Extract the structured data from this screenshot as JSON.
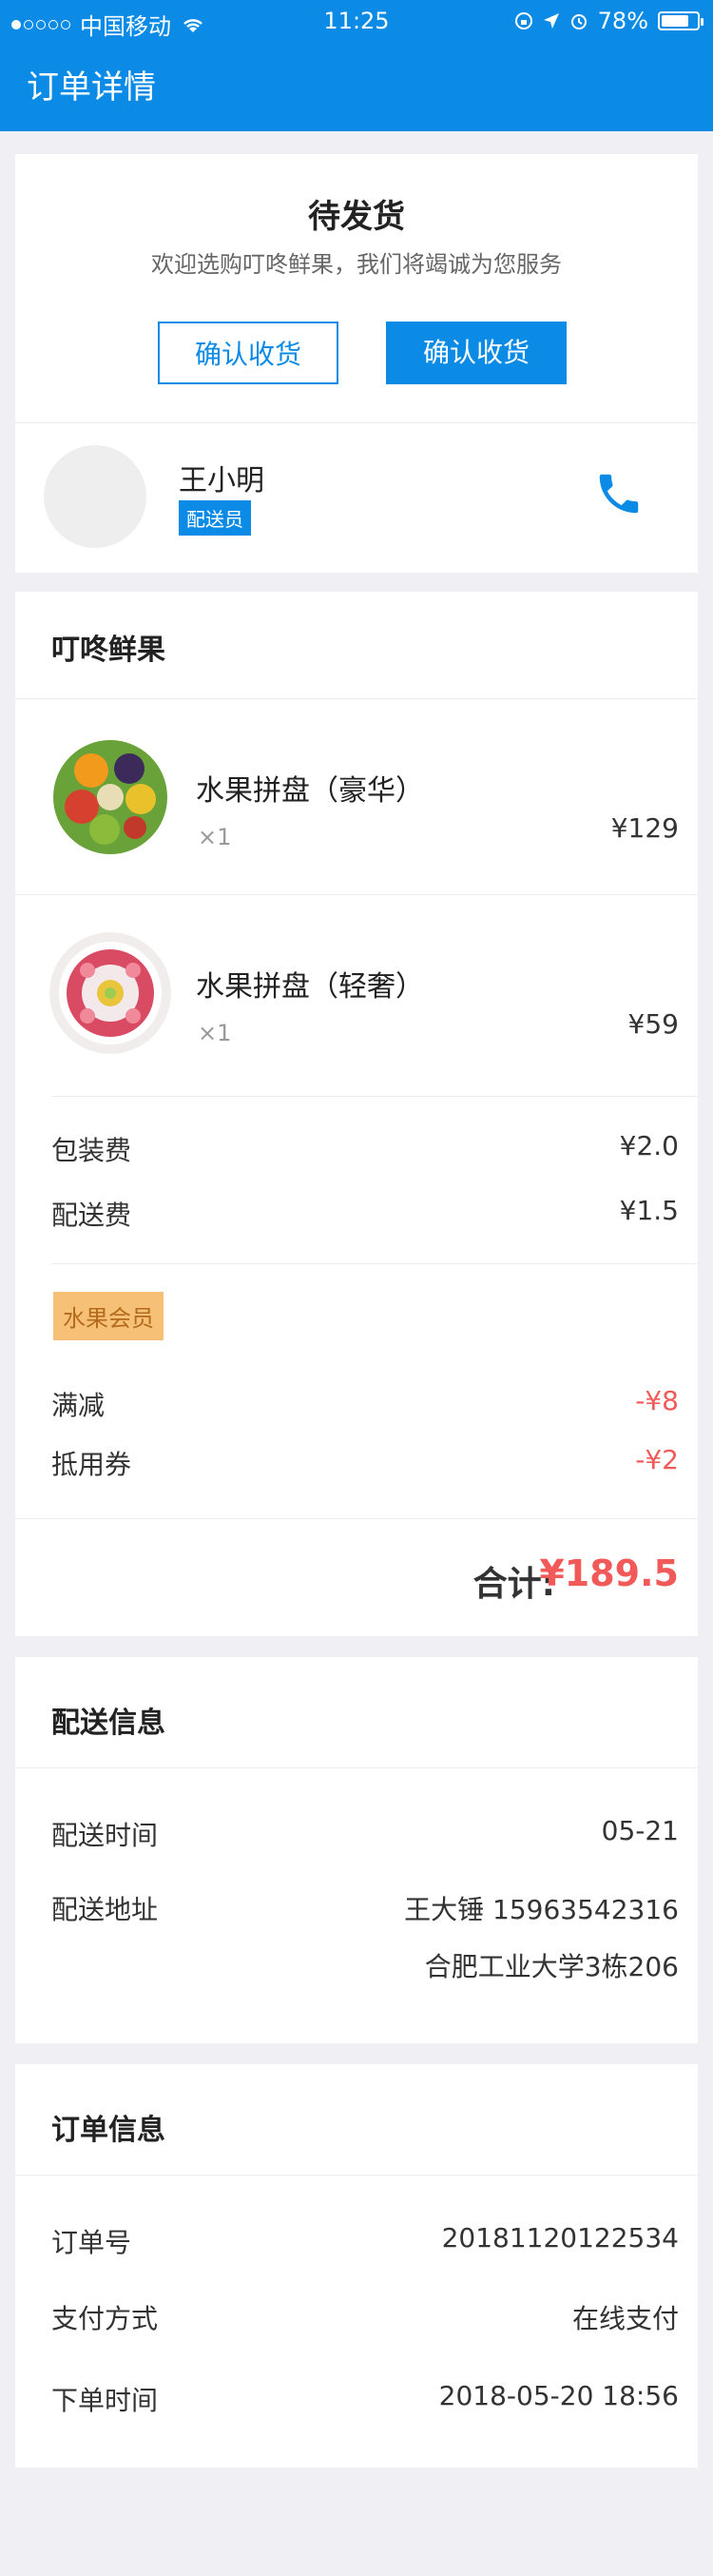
{
  "status_bar": {
    "carrier": "中国移动",
    "time": "11:25",
    "battery": "78%"
  },
  "header": {
    "title": "订单详情"
  },
  "order_status": {
    "title": "待发货",
    "subtitle": "欢迎选购叮咚鲜果，我们将竭诚为您服务",
    "buttons": {
      "left": "确认收货",
      "right": "确认收货"
    }
  },
  "courier": {
    "name": "王小明",
    "badge": "配送员"
  },
  "shop": {
    "name": "叮咚鲜果",
    "items": [
      {
        "name": "水果拼盘（豪华）",
        "qty": "×1",
        "price": "¥129"
      },
      {
        "name": "水果拼盘（轻奢）",
        "qty": "×1",
        "price": "¥59"
      }
    ],
    "fees": [
      {
        "label": "包装费",
        "value": "¥2.0"
      },
      {
        "label": "配送费",
        "value": "¥1.5"
      }
    ],
    "member_badge": "水果会员",
    "discounts": [
      {
        "label": "满减",
        "value": "-¥8"
      },
      {
        "label": "抵用券",
        "value": "-¥2"
      }
    ],
    "total_label": "合计:",
    "total_value": "¥189.5"
  },
  "delivery": {
    "title": "配送信息",
    "time_label": "配送时间",
    "time_value": "05-21",
    "address_label": "配送地址",
    "address_line1": "王大锤  15963542316",
    "address_line2": "合肥工业大学3栋206"
  },
  "order_info": {
    "title": "订单信息",
    "rows": [
      {
        "label": "订单号",
        "value": "20181120122534"
      },
      {
        "label": "支付方式",
        "value": "在线支付"
      },
      {
        "label": "下单时间",
        "value": "2018-05-20 18:56"
      }
    ]
  },
  "colors": {
    "brand": "#0b8be6",
    "price_red": "#f25a5a",
    "member": "#f6c177"
  }
}
